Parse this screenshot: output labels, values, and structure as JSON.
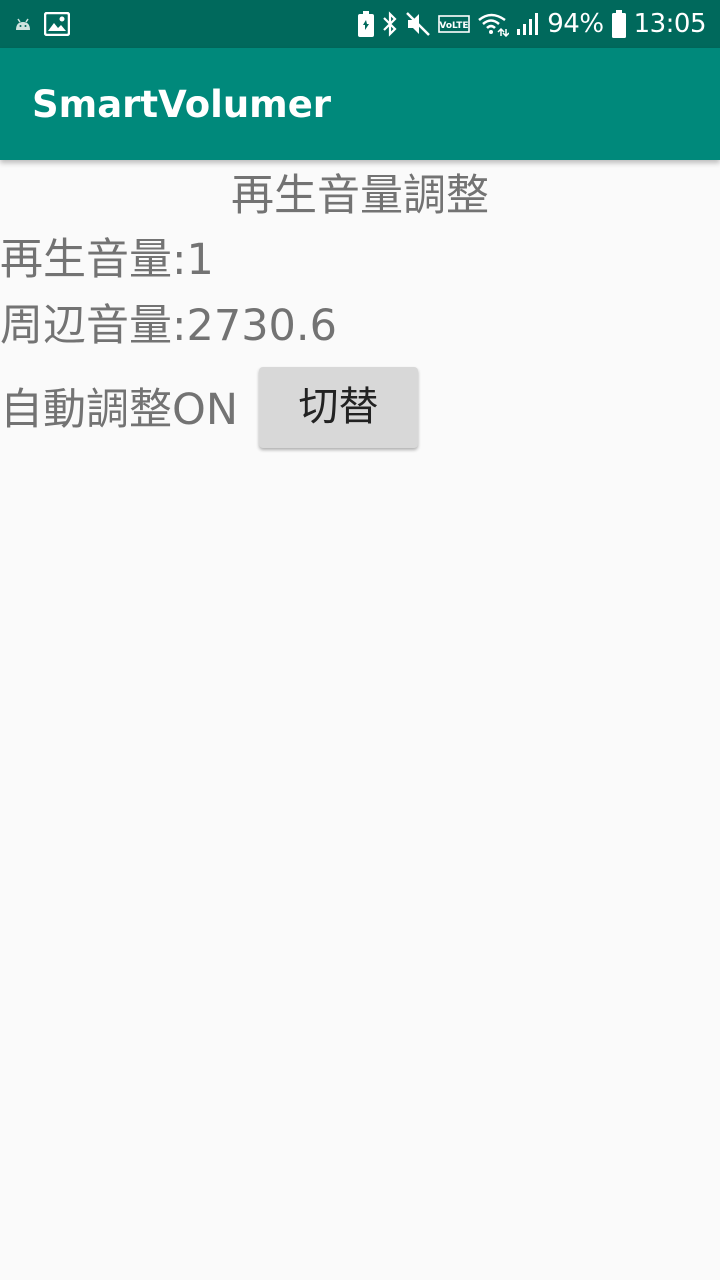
{
  "status_bar": {
    "battery_percent": "94%",
    "time": "13:05",
    "icons": [
      "android-icon",
      "image-icon",
      "battery-saver-icon",
      "bluetooth-icon",
      "mute-icon",
      "volte-icon",
      "wifi-icon",
      "signal-icon",
      "battery-icon"
    ],
    "volte_label": "VoLTE"
  },
  "app_bar": {
    "title": "SmartVolumer"
  },
  "main": {
    "heading": "再生音量調整",
    "playback_volume": "再生音量:1",
    "ambient_volume": "周辺音量:2730.6",
    "auto_adjust_status": "自動調整ON",
    "toggle_button_label": "切替"
  },
  "colors": {
    "status_bar": "#00695c",
    "app_bar": "#00897b",
    "background": "#fafafa",
    "text": "#737373",
    "button": "#d8d8d8"
  }
}
